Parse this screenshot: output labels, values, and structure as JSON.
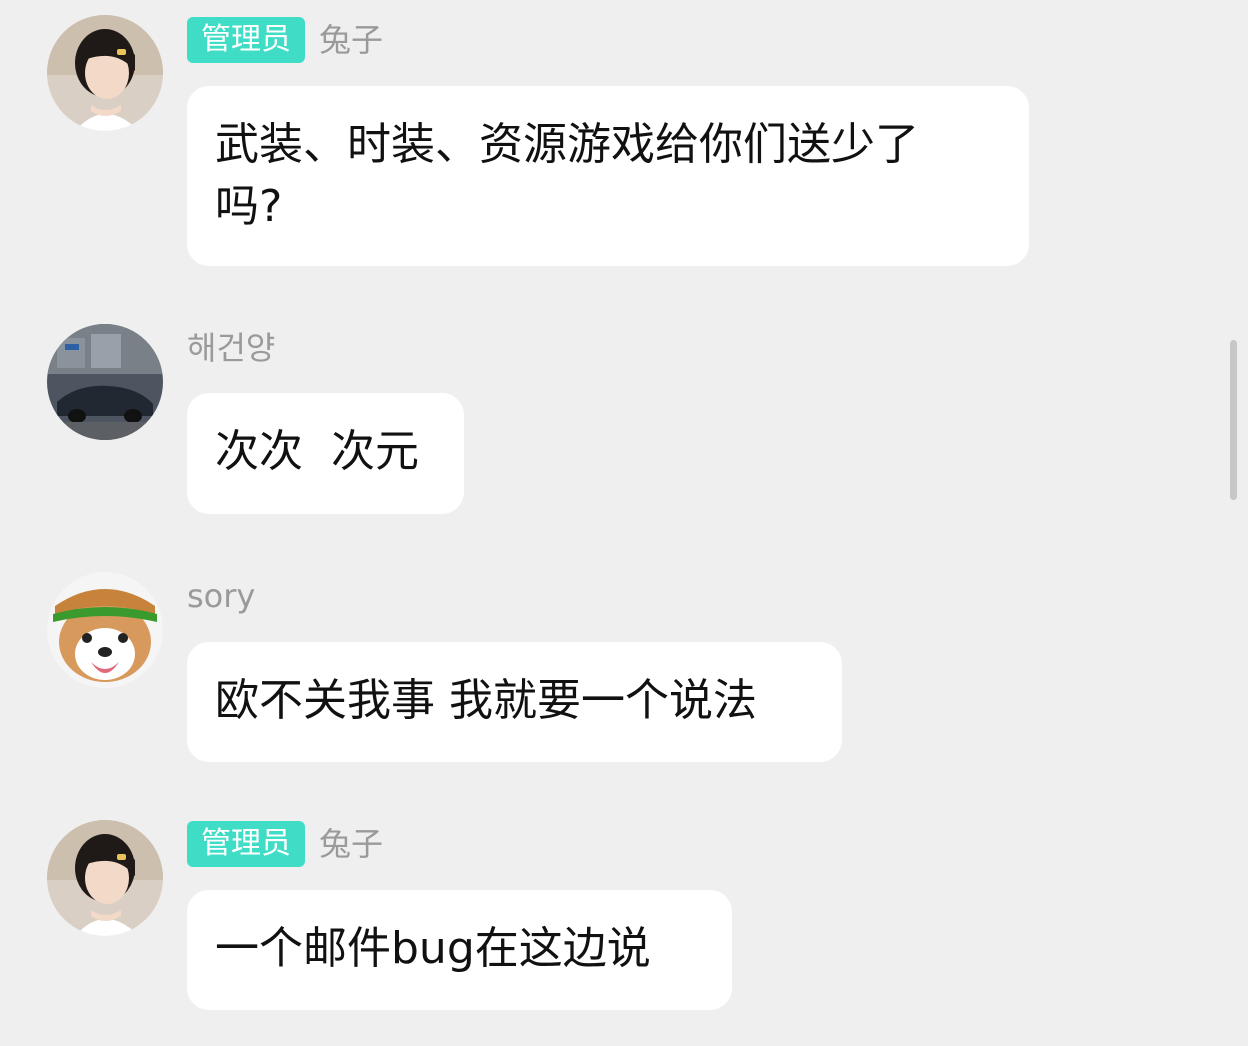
{
  "messages": [
    {
      "badge": "管理员",
      "name": "兔子",
      "text": "武装、时装、资源游戏给你们送少了\n吗?",
      "avatar": "girl-avatar"
    },
    {
      "badge": "",
      "name": "해건양",
      "text": "次次  次元",
      "avatar": "car-avatar"
    },
    {
      "badge": "",
      "name": "sory",
      "text": "欧不关我事 我就要一个说法",
      "avatar": "dog-avatar"
    },
    {
      "badge": "管理员",
      "name": "兔子",
      "text": "一个邮件bug在这边说",
      "avatar": "girl-avatar"
    }
  ],
  "colors": {
    "background": "#efefef",
    "badge": "#3fdcc6",
    "name": "#9a9a9a",
    "bubble": "#ffffff"
  }
}
